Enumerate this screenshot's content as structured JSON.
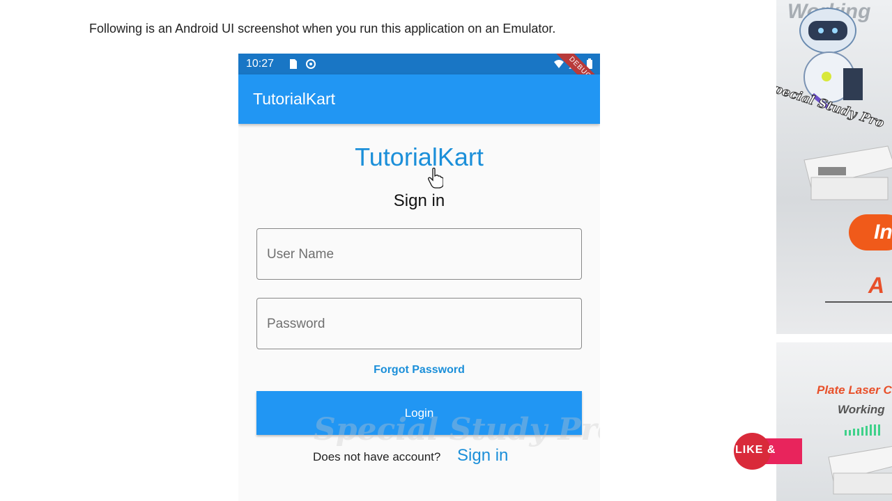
{
  "intro_text": "Following is an Android UI screenshot when you run this application on an Emulator.",
  "status_bar": {
    "time": "10:27",
    "debug_label": "DEBUG"
  },
  "app_bar": {
    "title": "TutorialKart"
  },
  "login": {
    "brand": "TutorialKart",
    "heading": "Sign in",
    "username_placeholder": "User Name",
    "password_placeholder": "Password",
    "forgot_label": "Forgot Password",
    "login_label": "Login",
    "no_account_text": "Does not have account?",
    "signin_link": "Sign in"
  },
  "watermark": "Special Study Pro",
  "ads": {
    "ad1_title": "Working",
    "ad1_button": "In",
    "ad1_sub": "A",
    "ad2_line1": "Plate Laser C",
    "ad2_line2": "Working"
  },
  "like_badge": {
    "label": "LIKE &"
  },
  "colors": {
    "status_bar": "#1976c5",
    "app_bar": "#2196f3",
    "accent_text": "#1b8fd9",
    "ad_orange": "#f05a1a",
    "like_red": "#d92a3a"
  }
}
